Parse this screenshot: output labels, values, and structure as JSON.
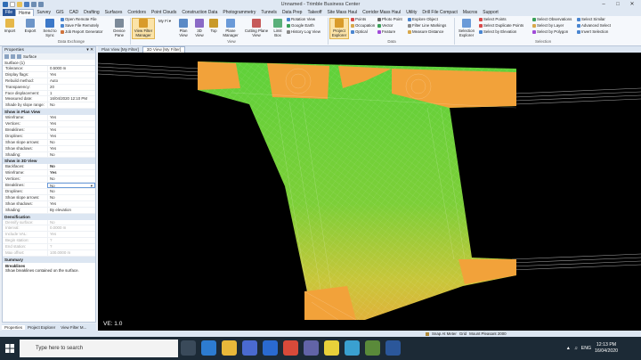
{
  "app": {
    "title": "Unnamed - Trimble Business Center"
  },
  "menu_tabs": [
    "File",
    "Home",
    "Survey",
    "GIS",
    "CAD",
    "Drafting",
    "Surfaces",
    "Corridors",
    "Point Clouds",
    "Construction Data",
    "Photogrammetry",
    "Tunnels",
    "Data Prep",
    "Takeoff",
    "Site Mass Haul",
    "Corridor Mass Haul",
    "Utility",
    "Drill File Compact",
    "Macros",
    "Support"
  ],
  "ribbon": {
    "import": "Import",
    "export": "Export",
    "send_to_sync": "Send to Sync",
    "open_remote_file": "Open Remote File",
    "save_file_remotely": "Save File Remotely",
    "job_report_generator": "Job Report Generator",
    "device_pane": "Device Pane",
    "data_exchange": "Data Exchange",
    "view_filter_manager": "View Filter Manager",
    "my_filter": "My Fi",
    "plan_view": "Plan View",
    "view_3d": "3D View",
    "top": "Top",
    "plane_manager": "Plane Manager",
    "cutting_plane_view": "Cutting Plane View",
    "limit_box": "Limit Box",
    "rotation_view": "Rotation View",
    "google_earth": "Google Earth",
    "history_log_view": "History Log View",
    "view_group": "View",
    "project_explorer": "Project Explorer",
    "points": "Points",
    "occupation": "Occupation",
    "optical": "Optical",
    "photo_point": "Photo Point",
    "vector": "Vector",
    "feature": "Feature",
    "explore_object": "Explore Object",
    "filter_line_markings": "Filter Line Markings",
    "measure_distance": "Measure Distance",
    "data_group": "Data",
    "selection_explorer": "Selection Explorer",
    "select_points": "Select Points",
    "select_duplicate_points": "Select Duplicate Points",
    "select_by_elevation": "Select by Elevation",
    "select_observations": "Select Observations",
    "select_by_layer": "Select by Layer",
    "select_by_polygon": "Select by Polygon",
    "select_similar": "Select Similar",
    "advanced_select": "Advanced Select",
    "invert_selection": "Invert Selection",
    "selection_group": "Selection"
  },
  "properties": {
    "header": "Properties",
    "selected_label": "Surface",
    "object": "Surface (1)",
    "rows_top": [
      {
        "k": "Tolerance:",
        "v": "0.5000 m"
      },
      {
        "k": "Display flags:",
        "v": "Yes"
      },
      {
        "k": "Rebuild method:",
        "v": "Auto"
      },
      {
        "k": "Transparency:",
        "v": "20"
      },
      {
        "k": "Face displacement:",
        "v": "1"
      },
      {
        "k": "Measured date:",
        "v": "16/04/2020 12:10 PM"
      },
      {
        "k": "Shade by slope range:",
        "v": "No"
      }
    ],
    "plan_header": "Show in Plan View",
    "rows_plan": [
      {
        "k": "Wireframe:",
        "v": "Yes"
      },
      {
        "k": "Vertices:",
        "v": "Yes"
      },
      {
        "k": "Breaklines:",
        "v": "Yes"
      },
      {
        "k": "Droplines:",
        "v": "Yes"
      },
      {
        "k": "Show slope arrows:",
        "v": "No"
      },
      {
        "k": "Show shadows:",
        "v": "Yes"
      },
      {
        "k": "Shading:",
        "v": "No"
      }
    ],
    "view3d_header": "Show in 3D View",
    "rows_3d": [
      {
        "k": "Backfaces:",
        "v": "No"
      },
      {
        "k": "Wireframe:",
        "v": "Yes"
      },
      {
        "k": "Vertices:",
        "v": "No"
      },
      {
        "k": "Breaklines:",
        "v": "No"
      },
      {
        "k": "Droplines:",
        "v": "No"
      },
      {
        "k": "Show slope arrows:",
        "v": "No"
      },
      {
        "k": "Show shadows:",
        "v": "Yes"
      },
      {
        "k": "Shading:",
        "v": "By elevation"
      }
    ],
    "densify_header": "Densification",
    "rows_densify": [
      {
        "k": "Densify surface:",
        "v": "No"
      },
      {
        "k": "Interval:",
        "v": "0.0000 m"
      },
      {
        "k": "Include VAL:",
        "v": "Yes"
      },
      {
        "k": "Begin station:",
        "v": "?"
      },
      {
        "k": "End station:",
        "v": "?"
      },
      {
        "k": "Max offset:",
        "v": "100.0000 m"
      }
    ],
    "summary_header": "Summary",
    "desc_title": "Breaklines",
    "desc_text": "Show breaklines contained on the surface."
  },
  "bottom_tabs": [
    "Properties",
    "Project Explorer",
    "View Filter M..."
  ],
  "view_tabs": [
    "Plan View [My Filter]",
    "3D View [My Filter]"
  ],
  "ve_label": "VE: 1.0",
  "status": {
    "snap": "Snap At Meter",
    "grid": "Grid",
    "location": "Mount Pleasant 2000"
  },
  "taskbar": {
    "search_placeholder": "Type here to search",
    "lang": "ENG",
    "time": "12:13 PM",
    "date": "16/04/2020"
  },
  "colors": {
    "accent": "#2b579a",
    "surface_orange": "#f2a23a",
    "surface_green": "#5fd13a"
  }
}
